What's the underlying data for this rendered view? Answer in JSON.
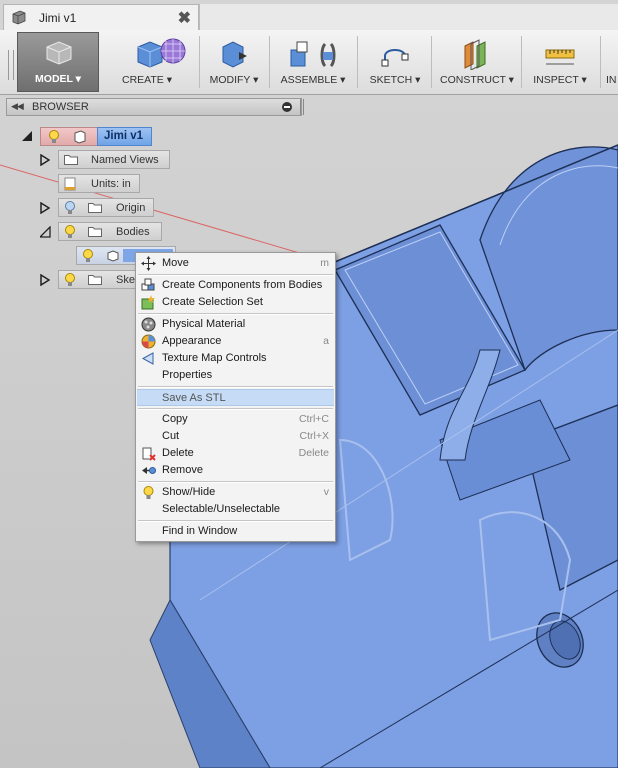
{
  "window": {
    "tab_title": "Jimi v1",
    "close_glyph": "✖"
  },
  "toolbar": {
    "model": "MODEL ▾",
    "tools": [
      {
        "id": "create",
        "label": "CREATE ▾",
        "icon": "create-box-icon"
      },
      {
        "id": "modify",
        "label": "MODIFY ▾",
        "icon": "modify-icon"
      },
      {
        "id": "assemble",
        "label": "ASSEMBLE ▾",
        "icon": "assemble-icon"
      },
      {
        "id": "sketch",
        "label": "SKETCH ▾",
        "icon": "sketch-icon"
      },
      {
        "id": "construct",
        "label": "CONSTRUCT ▾",
        "icon": "construct-plane-icon"
      },
      {
        "id": "inspect",
        "label": "INSPECT ▾",
        "icon": "measure-icon"
      },
      {
        "id": "insert",
        "label": "IN",
        "icon": "insert-icon"
      }
    ]
  },
  "browser": {
    "title": "BROWSER",
    "nodes": {
      "root": "Jimi v1",
      "named_views": "Named Views",
      "units": "Units: in",
      "origin": "Origin",
      "bodies": "Bodies",
      "sketches": "Sket"
    }
  },
  "context_menu": {
    "items": [
      {
        "label": "Move",
        "shortcut": "m",
        "icon": "move-arrows-icon"
      },
      {
        "label": "Create Components from Bodies",
        "shortcut": "",
        "icon": "components-icon"
      },
      {
        "label": "Create Selection Set",
        "shortcut": "",
        "icon": "selection-set-icon"
      },
      {
        "label": "Physical Material",
        "shortcut": "",
        "icon": "material-icon"
      },
      {
        "label": "Appearance",
        "shortcut": "a",
        "icon": "appearance-icon"
      },
      {
        "label": "Texture Map Controls",
        "shortcut": "",
        "icon": "texture-map-icon"
      },
      {
        "label": "Properties",
        "shortcut": "",
        "icon": ""
      },
      {
        "label": "Save As STL",
        "shortcut": "",
        "icon": ""
      },
      {
        "label": "Copy",
        "shortcut": "Ctrl+C",
        "icon": ""
      },
      {
        "label": "Cut",
        "shortcut": "Ctrl+X",
        "icon": ""
      },
      {
        "label": "Delete",
        "shortcut": "Delete",
        "icon": "delete-icon"
      },
      {
        "label": "Remove",
        "shortcut": "",
        "icon": "remove-icon"
      },
      {
        "label": "Show/Hide",
        "shortcut": "v",
        "icon": "lightbulb-icon"
      },
      {
        "label": "Selectable/Unselectable",
        "shortcut": "",
        "icon": ""
      },
      {
        "label": "Find in Window",
        "shortcut": "",
        "icon": ""
      }
    ]
  },
  "colors": {
    "body_blue": "#7a9fe0",
    "highlight": "#c6dbf5",
    "root_red": "#e2a9a9"
  }
}
